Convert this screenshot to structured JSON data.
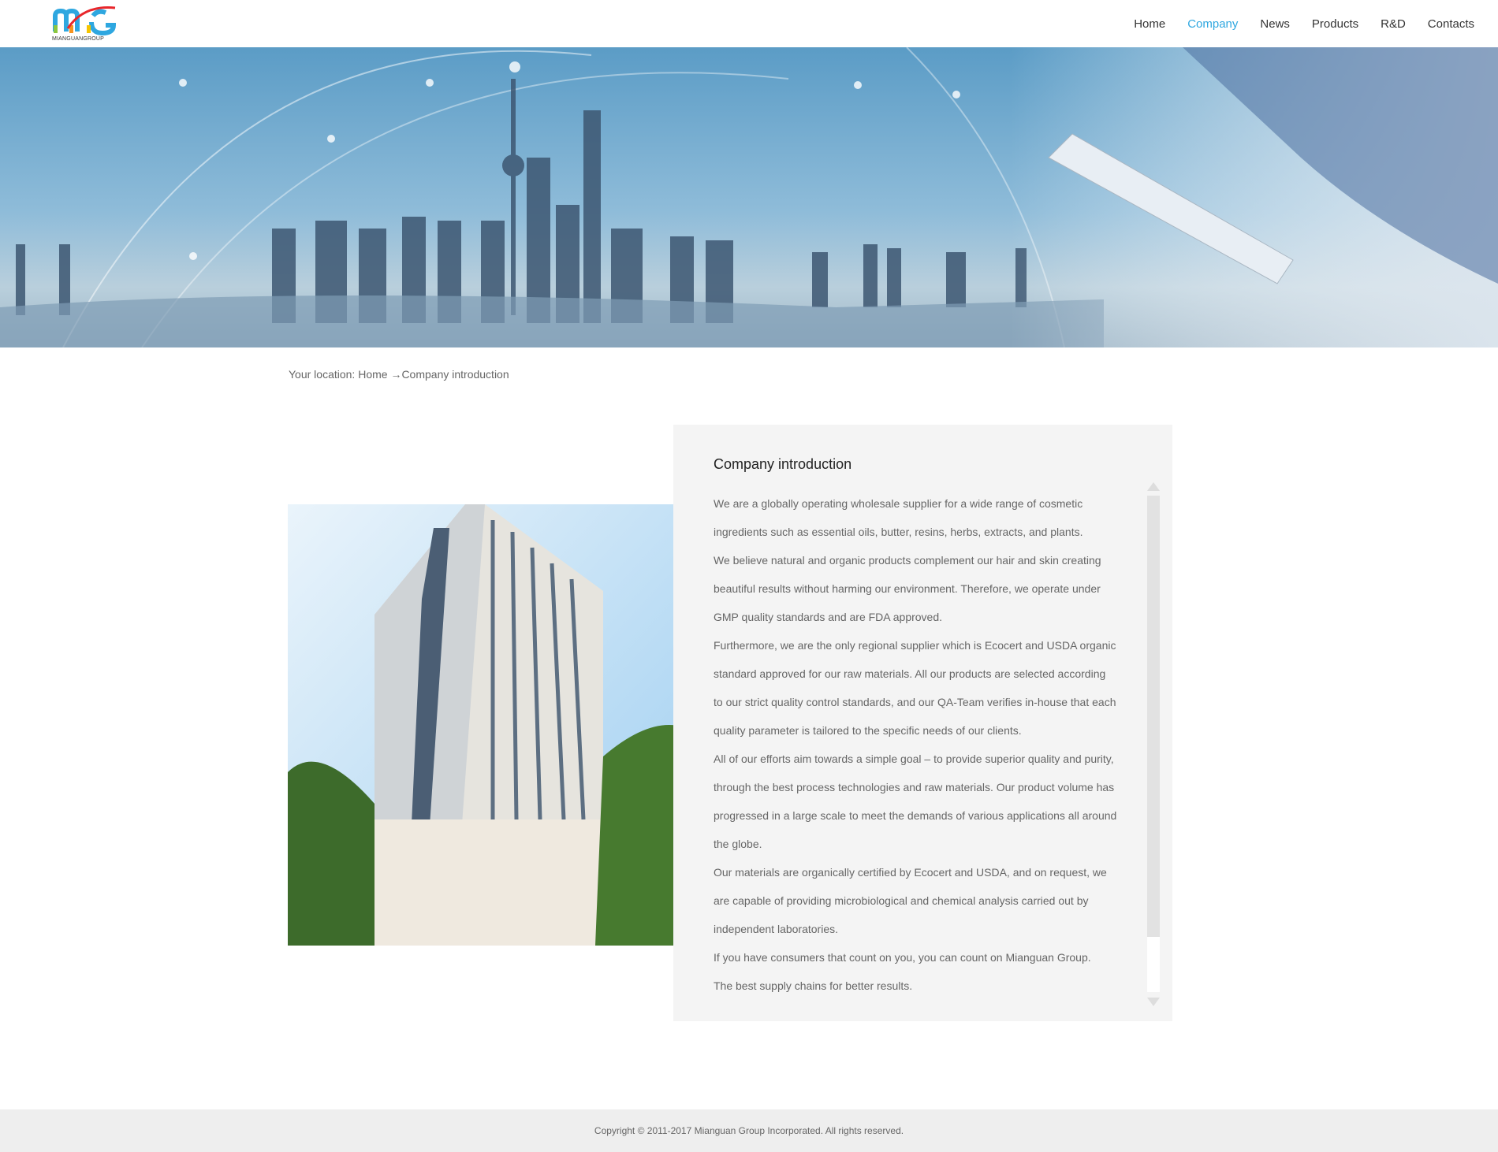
{
  "header": {
    "logo_text": "MIANGUANGROUP",
    "nav": [
      {
        "label": "Home"
      },
      {
        "label": "Company",
        "active": true
      },
      {
        "label": "News"
      },
      {
        "label": "Products"
      },
      {
        "label": "R&D"
      },
      {
        "label": "Contacts"
      }
    ],
    "accent": "#2ea7e0"
  },
  "breadcrumb": "Your location: Home →Company introduction",
  "panel": {
    "title": "Company introduction",
    "lines": [
      "We are a globally operating wholesale supplier for a wide range of cosmetic",
      " ingredients such as essential oils, butter, resins, herbs, extracts, and plants.",
      "We believe natural and organic products complement our hair and skin creating",
      " beautiful results without harming our environment. Therefore, we operate under",
      " GMP quality standards and are FDA approved.",
      "Furthermore, we are the only regional supplier which is Ecocert and USDA organic",
      "standard approved for our raw materials. All our products are selected according",
      "to our strict quality control standards, and our QA-Team verifies in-house that each",
      "quality parameter is tailored to the specific needs of our clients.",
      "All of our efforts aim towards a simple goal – to provide superior quality and purity,",
      " through the best process technologies and raw materials. Our product volume has",
      " progressed in a large scale to meet the demands of various applications all around",
      "the globe.",
      "Our materials are organically certified by Ecocert and USDA, and on request, we",
      " are capable of providing microbiological and chemical analysis carried out by",
      " independent laboratories.",
      "If you have consumers that count on you, you can count on Mianguan Group.",
      "The best supply chains for better results."
    ]
  },
  "footer": {
    "copyright": "Copyright © 2011-2017 Mianguan Group Incorporated. All rights reserved."
  }
}
